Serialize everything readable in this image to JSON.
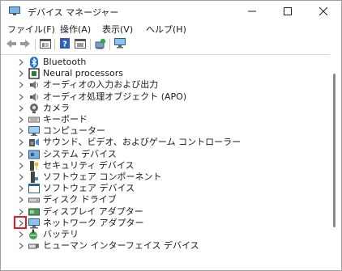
{
  "window": {
    "title": "デバイス マネージャー"
  },
  "menu": [
    {
      "label": "ファイル(F)"
    },
    {
      "label": "操作(A)"
    },
    {
      "label": "表示(V)"
    },
    {
      "label": "ヘルプ(H)"
    }
  ],
  "toolbar": {
    "buttons": [
      {
        "icon": "back-arrow-icon"
      },
      {
        "icon": "forward-arrow-icon"
      },
      {
        "icon": "properties-window-icon"
      },
      {
        "icon": "details-window-icon"
      },
      {
        "icon": "help-icon"
      },
      {
        "icon": "view-window-icon"
      },
      {
        "icon": "scan-hardware-icon"
      },
      {
        "icon": "monitor-icon"
      }
    ]
  },
  "tree": {
    "items": [
      {
        "label": "Bluetooth",
        "icon": "bluetooth-icon"
      },
      {
        "label": "Neural processors",
        "icon": "chip-icon"
      },
      {
        "label": "オーディオの入力および出力",
        "icon": "speaker-icon"
      },
      {
        "label": "オーディオ処理オブジェクト (APO)",
        "icon": "speaker-icon"
      },
      {
        "label": "カメラ",
        "icon": "camera-icon"
      },
      {
        "label": "キーボード",
        "icon": "keyboard-icon"
      },
      {
        "label": "コンピューター",
        "icon": "computer-icon"
      },
      {
        "label": "サウンド、ビデオ、およびゲーム コントローラー",
        "icon": "sound-icon"
      },
      {
        "label": "システム デバイス",
        "icon": "system-folder-icon"
      },
      {
        "label": "セキュリティ デバイス",
        "icon": "security-key-icon"
      },
      {
        "label": "ソフトウェア コンポーネント",
        "icon": "software-component-icon"
      },
      {
        "label": "ソフトウェア デバイス",
        "icon": "software-device-icon"
      },
      {
        "label": "ディスク ドライブ",
        "icon": "disk-drive-icon"
      },
      {
        "label": "ディスプレイ アダプター",
        "icon": "display-adapter-icon"
      },
      {
        "label": "ネットワーク アダプター",
        "icon": "network-adapter-icon",
        "highlighted": true
      },
      {
        "label": "バッテリ",
        "icon": "battery-icon"
      },
      {
        "label": "ヒューマン インターフェイス デバイス",
        "icon": "hid-icon"
      }
    ]
  },
  "colors": {
    "highlight_box": "#e0201c",
    "accent": "#2b6fc7"
  }
}
